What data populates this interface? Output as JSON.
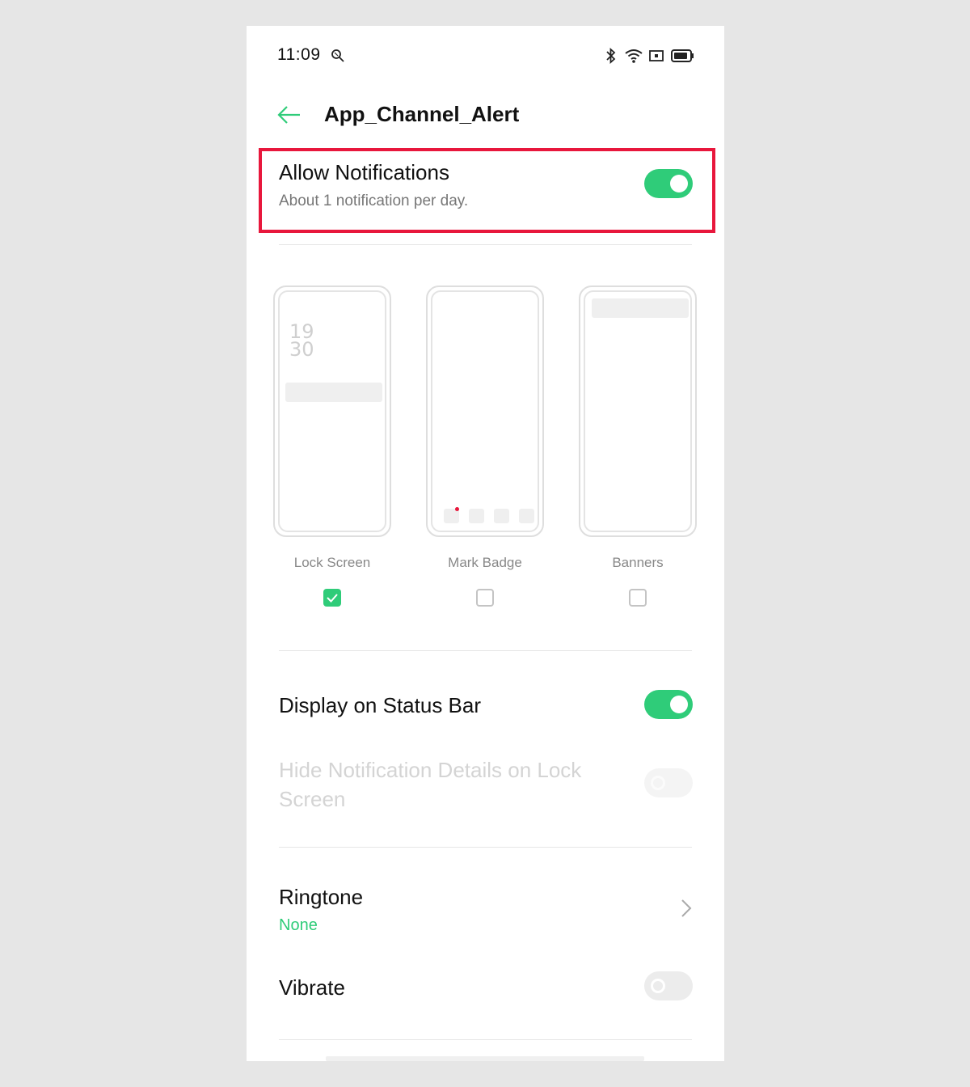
{
  "status_bar": {
    "time": "11:09",
    "icons": [
      "search-status-icon",
      "bluetooth-icon",
      "wifi-icon",
      "screen-cast-icon",
      "battery-icon"
    ]
  },
  "header": {
    "title": "App_Channel_Alert",
    "back_icon": "arrow-left-icon"
  },
  "allow_notifications": {
    "title": "Allow Notifications",
    "subtitle": "About 1 notification per day.",
    "enabled": true
  },
  "styles": {
    "lock_screen": {
      "label": "Lock Screen",
      "checked": true,
      "clock_hour": "19",
      "clock_minute": "30"
    },
    "mark_badge": {
      "label": "Mark Badge",
      "checked": false
    },
    "banners": {
      "label": "Banners",
      "checked": false
    }
  },
  "display_status_bar": {
    "title": "Display on Status Bar",
    "enabled": true
  },
  "hide_details": {
    "title_line1": "Hide Notification Details on Lock",
    "title_line2": "Screen",
    "enabled": false,
    "disabled": true
  },
  "ringtone": {
    "title": "Ringtone",
    "value": "None"
  },
  "vibrate": {
    "title": "Vibrate",
    "enabled": false
  },
  "colors": {
    "accent": "#2fcc79",
    "highlight_border": "#e8173c",
    "badge_dot": "#e8173c"
  }
}
